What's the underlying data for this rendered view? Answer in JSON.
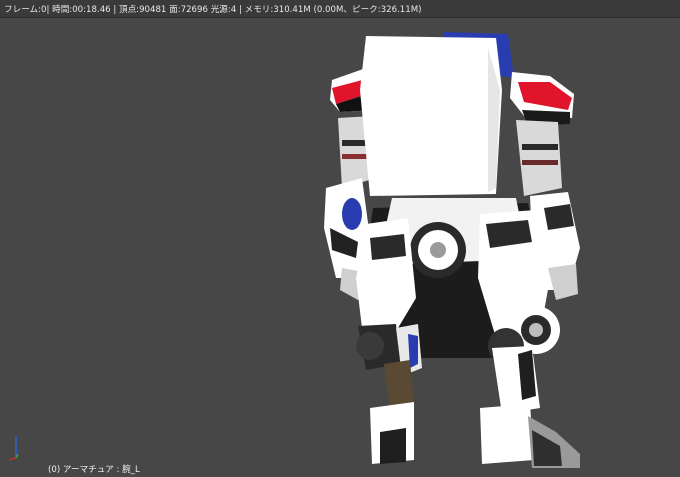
{
  "header": {
    "stats": "フレーム:0| 時間:00:18.46 | 頂点:90481 面:72696 光源:4 | メモリ:310.41M (0.00M、ピーク:326.11M)"
  },
  "viewport": {
    "background_color": "#474747",
    "object_label": "(0) アーマチュア : 腕_L"
  },
  "scene": {
    "model": "robot-mesh",
    "accent_colors": [
      "#e0142a",
      "#2a3db0",
      "#ffffff"
    ]
  },
  "gizmo": {
    "icon": "xyz-axis-icon"
  }
}
